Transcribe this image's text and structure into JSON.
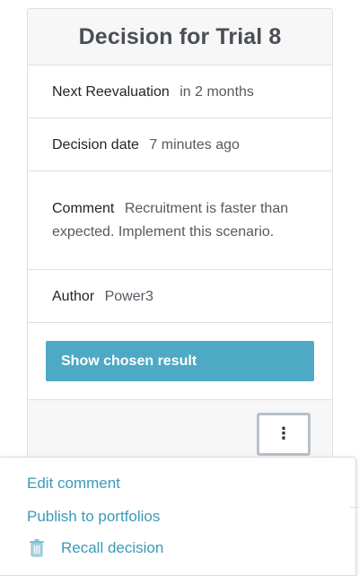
{
  "card": {
    "title": "Decision for Trial 8",
    "fields": {
      "next_reevaluation": {
        "label": "Next Reevaluation",
        "value": "in 2 months"
      },
      "decision_date": {
        "label": "Decision date",
        "value": "7 minutes ago"
      },
      "comment": {
        "label": "Comment",
        "value": "Recruitment is faster than expected. Implement this scenario."
      },
      "author": {
        "label": "Author",
        "value": "Power3"
      }
    },
    "primary_button_label": "Show chosen result",
    "more_button_glyph": "⋮"
  },
  "menu": {
    "items": [
      {
        "label": "Edit comment"
      },
      {
        "label": "Publish to portfolios"
      },
      {
        "label": "Recall decision",
        "icon": "trash-icon"
      }
    ]
  },
  "colors": {
    "accent": "#4da9c4",
    "link": "#3a9ab8",
    "header_bg": "#f7f7f7",
    "border": "#dfdfdf"
  }
}
